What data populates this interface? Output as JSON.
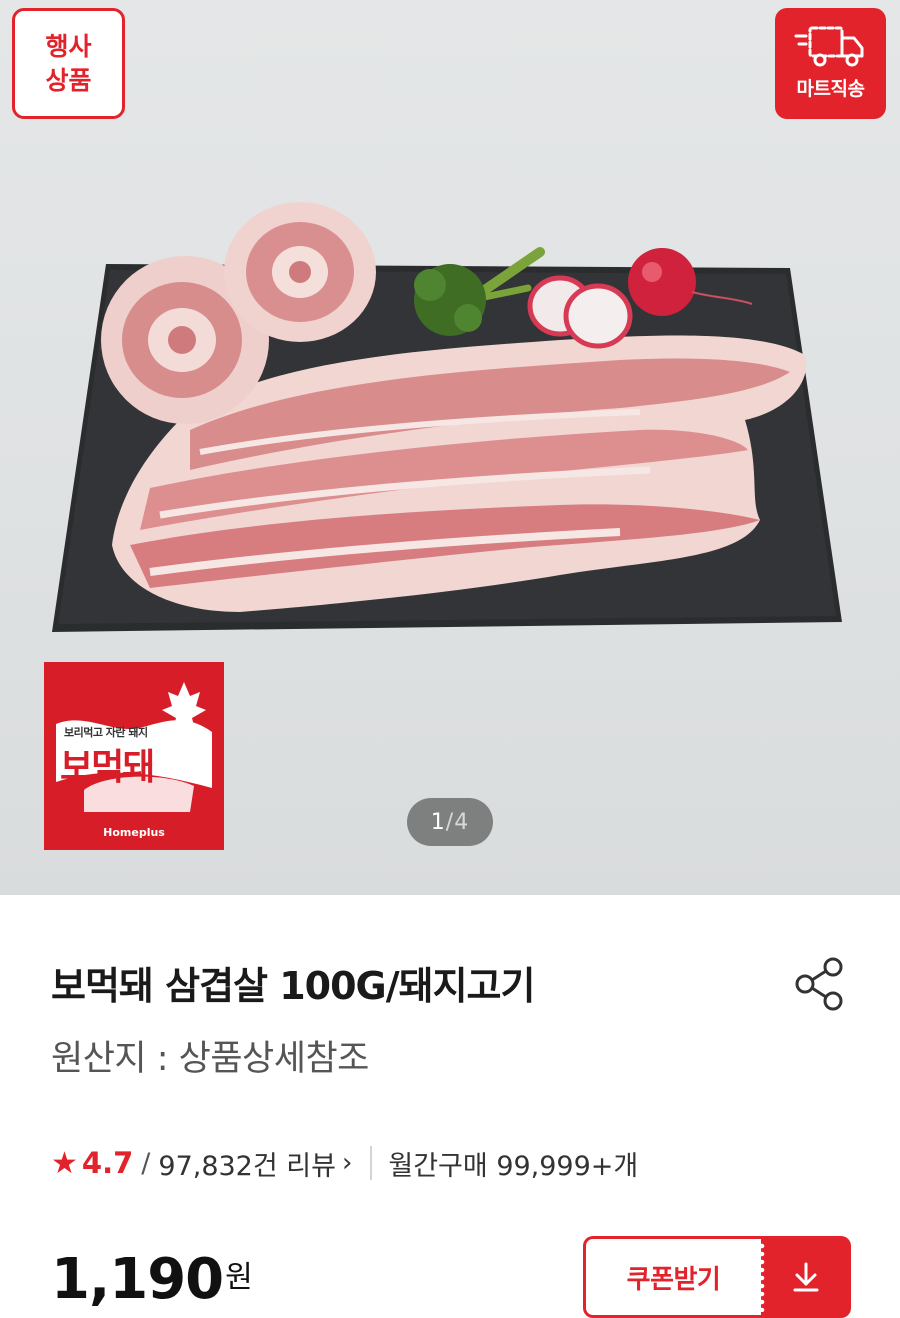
{
  "badges": {
    "sale_line1": "행사",
    "sale_line2": "상품",
    "direct_label": "마트직송",
    "direct_icon": "delivery-truck-icon"
  },
  "brand_logo": {
    "sub": "보리먹고 자란 돼지",
    "name": "보먹돼",
    "maker": "Homeplus"
  },
  "gallery": {
    "current": "1",
    "separator": "/",
    "total": "4"
  },
  "product": {
    "title": "보먹돼 삼겹살 100G/돼지고기",
    "origin_label": "원산지 : ",
    "origin_value": "상품상세참조"
  },
  "rating": {
    "star_icon": "star-icon",
    "score": "4.7",
    "slash": "/",
    "reviews": "97,832건 리뷰",
    "chevron": "›",
    "monthly": "월간구매 99,999+개"
  },
  "price": {
    "amount": "1,190",
    "unit": "원"
  },
  "coupon": {
    "label": "쿠폰받기",
    "icon": "download-icon"
  },
  "colors": {
    "accent": "#e3232b",
    "logo_red": "#d71e28"
  }
}
